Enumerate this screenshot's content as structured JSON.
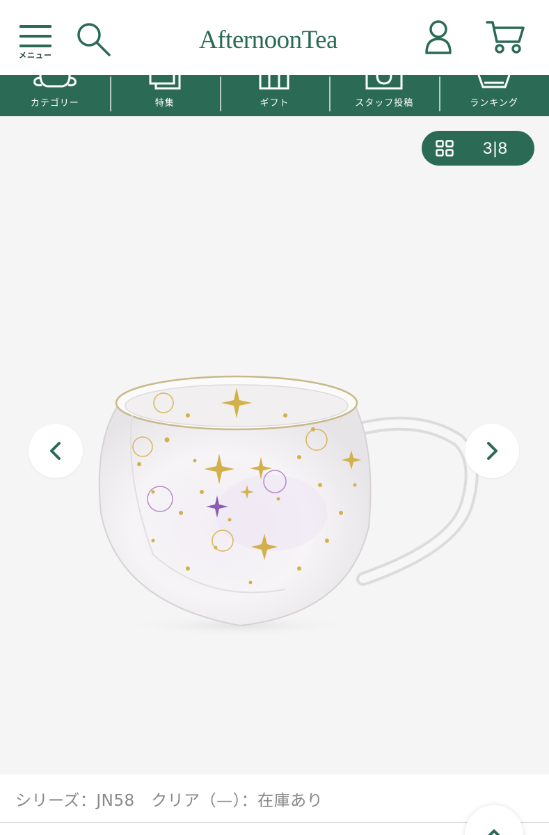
{
  "header": {
    "menu_label": "メニュー",
    "logo_text": "AfternoonTea",
    "icons": [
      "menu-icon",
      "search-icon",
      "account-icon",
      "cart-icon"
    ]
  },
  "category_nav": {
    "items": [
      {
        "label": "カテゴリー",
        "icon": "category-icon"
      },
      {
        "label": "特集",
        "icon": "feature-icon"
      },
      {
        "label": "ギフト",
        "icon": "gift-icon"
      },
      {
        "label": "スタッフ投稿",
        "icon": "staff-post-icon"
      },
      {
        "label": "ランキング",
        "icon": "ranking-icon"
      }
    ]
  },
  "gallery": {
    "counter": "3|8",
    "image": "glass-mug-product-photo"
  },
  "product": {
    "variant_text": "シリーズ：JN58　クリア（—）：在庫あり"
  },
  "colors": {
    "brand_green": "#2b6b55",
    "gallery_bg": "#f5f5f5",
    "muted_text": "#888888"
  }
}
